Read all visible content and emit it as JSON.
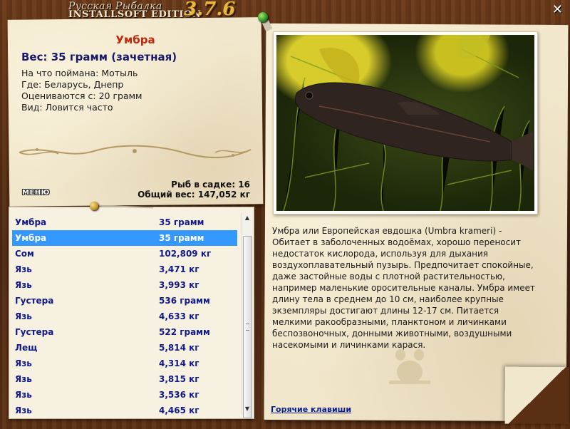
{
  "window": {
    "title_top": "Русская Рыбалка",
    "title_main": "INSTALLSOFT EDITION",
    "version": "3.7.6",
    "close_icon": "close-icon"
  },
  "fish_card": {
    "name": "Умбра",
    "weight": "Вес: 35 грамм (зачетная)",
    "bait": "На что поймана: Мотыль",
    "location": "Где: Беларусь, Днепр",
    "value_from": "Оцениваются с: 20 грамм",
    "kind": "Вид: Ловится часто"
  },
  "stats": {
    "in_keepnet": "Рыб в садке: 16",
    "total_weight": "Общий вес: 147,052 кг"
  },
  "menu": {
    "label": "МЕНЮ"
  },
  "catch_list": {
    "selected_index": 1,
    "rows": [
      {
        "name": "Умбра",
        "weight": "35 грамм"
      },
      {
        "name": "Умбра",
        "weight": "35 грамм"
      },
      {
        "name": "Сом",
        "weight": "102,809 кг"
      },
      {
        "name": "Язь",
        "weight": "3,471 кг"
      },
      {
        "name": "Язь",
        "weight": "3,993 кг"
      },
      {
        "name": "Густера",
        "weight": "536 грамм"
      },
      {
        "name": "Язь",
        "weight": "4,633 кг"
      },
      {
        "name": "Густера",
        "weight": "522 грамм"
      },
      {
        "name": "Лещ",
        "weight": "5,814 кг"
      },
      {
        "name": "Язь",
        "weight": "4,314 кг"
      },
      {
        "name": "Язь",
        "weight": "3,815 кг"
      },
      {
        "name": "Язь",
        "weight": "3,536 кг"
      },
      {
        "name": "Язь",
        "weight": "4,465 кг"
      }
    ]
  },
  "description": "Умбра или Европейская евдошка (Umbra krameri) - Обитает в заболоченных водоёмах, хорошо переносит недостаток кислорода, используя для дыхания воздухоплавательный пузырь. Предпочитает спокойные, даже застойные воды с плотной растительностью, например маленькие оросительные каналы. Умбра имеет длину тела в среднем до 10 см, наиболее крупные экземпляры достигают длины 12-17 см. Питается мелкими ракообразными, планктоном и личинками беспозвоночных, донными животными, воздушными насекомыми и личинками карася.",
  "hotkeys": {
    "label": "Горячие клавиши"
  },
  "colors": {
    "fish_name": "#c0280c",
    "accent_blue": "#101a8a",
    "selection": "#3399ff",
    "paper": "#f1e7cc",
    "wood": "#5a2f14"
  }
}
